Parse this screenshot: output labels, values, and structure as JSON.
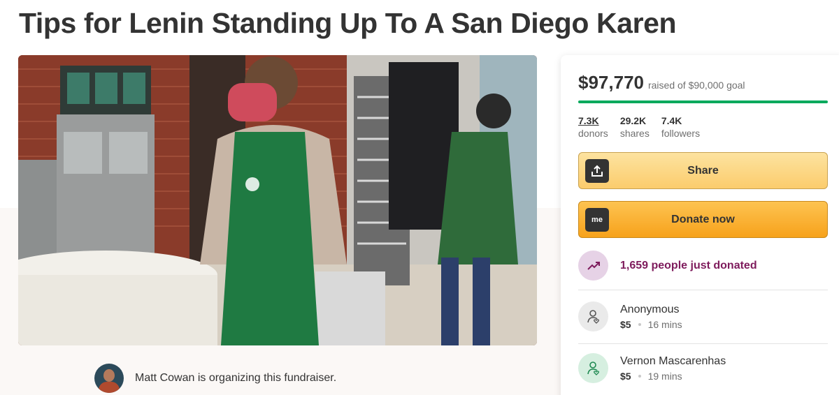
{
  "page": {
    "title": "Tips for Lenin Standing Up To A San Diego Karen"
  },
  "organizer": {
    "text": "Matt Cowan is organizing this fundraiser."
  },
  "donation_card": {
    "raised_amount": "$97,770",
    "goal_text": "raised of $90,000 goal",
    "progress_fraction": 1.0,
    "stats": [
      {
        "value": "7.3K",
        "label": "donors"
      },
      {
        "value": "29.2K",
        "label": "shares"
      },
      {
        "value": "7.4K",
        "label": "followers"
      }
    ],
    "share_label": "Share",
    "donate_label": "Donate now",
    "donate_icon_text": "me",
    "recent_activity": "1,659 people just donated",
    "donors": [
      {
        "name": "Anonymous",
        "amount": "$5",
        "time": "16 mins",
        "icon_color": "#eaeaea",
        "icon_stroke": "#555555"
      },
      {
        "name": "Vernon Mascarenhas",
        "amount": "$5",
        "time": "19 mins",
        "icon_color": "#d6efe0",
        "icon_stroke": "#1f8a52"
      }
    ]
  },
  "colors": {
    "progress": "#02a95c",
    "trend_bg": "#e6d2e6",
    "trend_text": "#7e1b5c",
    "share_button": "#fbcc6d",
    "donate_button": "#f7a21b"
  },
  "icons": {
    "share": "share-upload-icon",
    "donate": "gofundme-logo-icon",
    "trend": "trending-up-icon",
    "donor": "person-heart-icon"
  }
}
